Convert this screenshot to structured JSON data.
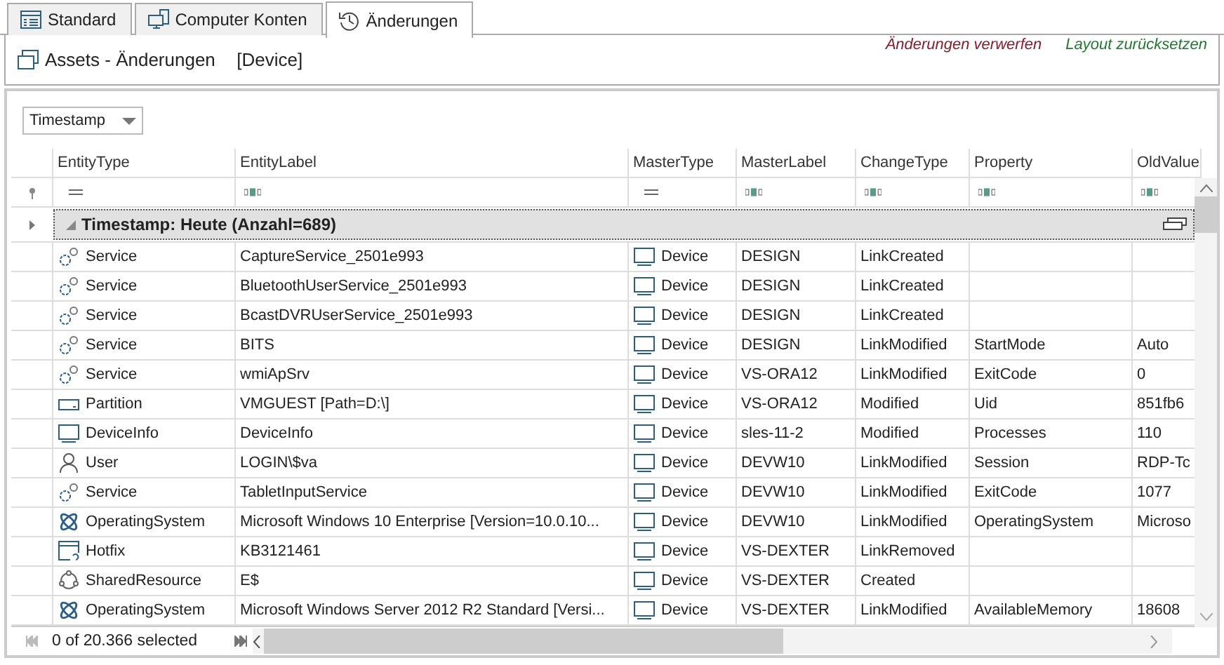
{
  "tabs": [
    {
      "label": "Standard",
      "kind": "table",
      "selected": false
    },
    {
      "label": "Computer Konten",
      "kind": "computer",
      "selected": false
    },
    {
      "label": "Änderungen",
      "kind": "history",
      "selected": true
    }
  ],
  "header": {
    "title": "Assets - Änderungen",
    "context": "[Device]",
    "links": [
      {
        "label": "Änderungen verwerfen",
        "color": "#8b1a2a"
      },
      {
        "label": "Layout zurücksetzen",
        "color": "#1e7a2e"
      }
    ]
  },
  "group_by": {
    "value": "Timestamp"
  },
  "grid": {
    "columns": [
      {
        "label": "EntityType",
        "kind": "equals"
      },
      {
        "label": "EntityLabel",
        "kind": "text"
      },
      {
        "label": "MasterType",
        "kind": "equals"
      },
      {
        "label": "MasterLabel",
        "kind": "text"
      },
      {
        "label": "ChangeType",
        "kind": "text"
      },
      {
        "label": "Property",
        "kind": "text"
      },
      {
        "label": "OldValue",
        "kind": "text"
      }
    ],
    "group_row": {
      "label": "Timestamp: Heute (Anzahl=689)",
      "expanded": true
    },
    "rows": [
      {
        "kind": "service",
        "entity_type": "Service",
        "entity_label": "CaptureService_2501e993",
        "master_type": "Device",
        "master_label": "DESIGN",
        "change_type": "LinkCreated"
      },
      {
        "kind": "service",
        "entity_type": "Service",
        "entity_label": "BluetoothUserService_2501e993",
        "master_type": "Device",
        "master_label": "DESIGN",
        "change_type": "LinkCreated"
      },
      {
        "kind": "service",
        "entity_type": "Service",
        "entity_label": "BcastDVRUserService_2501e993",
        "master_type": "Device",
        "master_label": "DESIGN",
        "change_type": "LinkCreated"
      },
      {
        "kind": "service",
        "entity_type": "Service",
        "entity_label": "BITS",
        "master_type": "Device",
        "master_label": "DESIGN",
        "change_type": "LinkModified",
        "property": "StartMode",
        "old_value": "Auto"
      },
      {
        "kind": "service",
        "entity_type": "Service",
        "entity_label": "wmiApSrv",
        "master_type": "Device",
        "master_label": "VS-ORA12",
        "change_type": "LinkModified",
        "property": "ExitCode",
        "old_value": "0"
      },
      {
        "kind": "partition",
        "entity_type": "Partition",
        "entity_label": "VMGUEST [Path=D:\\]",
        "master_type": "Device",
        "master_label": "VS-ORA12",
        "change_type": "Modified",
        "property": "Uid",
        "old_value": "851fb6"
      },
      {
        "kind": "device",
        "entity_type": "DeviceInfo",
        "entity_label": "DeviceInfo",
        "master_type": "Device",
        "master_label": "sles-11-2",
        "change_type": "Modified",
        "property": "Processes",
        "old_value": "110"
      },
      {
        "kind": "user",
        "entity_type": "User",
        "entity_label": "LOGIN\\$va",
        "master_type": "Device",
        "master_label": "DEVW10",
        "change_type": "LinkModified",
        "property": "Session",
        "old_value": "RDP-Tc"
      },
      {
        "kind": "service",
        "entity_type": "Service",
        "entity_label": "TabletInputService",
        "master_type": "Device",
        "master_label": "DEVW10",
        "change_type": "LinkModified",
        "property": "ExitCode",
        "old_value": "1077"
      },
      {
        "kind": "os",
        "entity_type": "OperatingSystem",
        "entity_label": "Microsoft Windows 10 Enterprise [Version=10.0.10...",
        "master_type": "Device",
        "master_label": "DEVW10",
        "change_type": "LinkModified",
        "property": "OperatingSystem",
        "old_value": "Microso"
      },
      {
        "kind": "hotfix",
        "entity_type": "Hotfix",
        "entity_label": "KB3121461",
        "master_type": "Device",
        "master_label": "VS-DEXTER",
        "change_type": "LinkRemoved"
      },
      {
        "kind": "share",
        "entity_type": "SharedResource",
        "entity_label": "E$",
        "master_type": "Device",
        "master_label": "VS-DEXTER",
        "change_type": "Created"
      },
      {
        "kind": "os",
        "entity_type": "OperatingSystem",
        "entity_label": "Microsoft Windows Server 2012 R2 Standard [Versi...",
        "master_type": "Device",
        "master_label": "VS-DEXTER",
        "change_type": "LinkModified",
        "property": "AvailableMemory",
        "old_value": "18608"
      }
    ]
  },
  "status": "0 of 20.366 selected"
}
